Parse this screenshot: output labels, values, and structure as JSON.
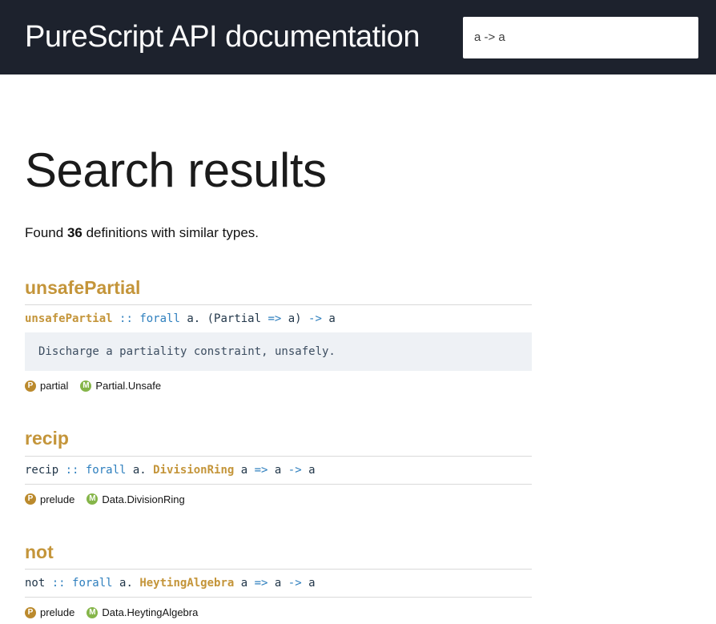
{
  "header": {
    "title": "PureScript API documentation",
    "search": {
      "value": "a -> a"
    }
  },
  "page": {
    "heading": "Search results",
    "summary": {
      "prefix": "Found ",
      "count": "36",
      "suffix": " definitions with similar types."
    }
  },
  "badges": {
    "package_letter": "P",
    "module_letter": "M"
  },
  "results": [
    {
      "title": "unsafePartial",
      "signature": [
        {
          "text": "unsafePartial",
          "kind": "decl"
        },
        {
          "text": " ",
          "kind": "plain"
        },
        {
          "text": "::",
          "kind": "keyword"
        },
        {
          "text": " ",
          "kind": "plain"
        },
        {
          "text": "forall",
          "kind": "keyword"
        },
        {
          "text": " a. (Partial ",
          "kind": "plain"
        },
        {
          "text": "=>",
          "kind": "keyword"
        },
        {
          "text": " a) ",
          "kind": "plain"
        },
        {
          "text": "->",
          "kind": "keyword"
        },
        {
          "text": " a",
          "kind": "plain"
        }
      ],
      "description": "Discharge a partiality constraint, unsafely.",
      "package": "partial",
      "module": "Partial.Unsafe"
    },
    {
      "title": "recip",
      "signature": [
        {
          "text": "recip ",
          "kind": "plain"
        },
        {
          "text": "::",
          "kind": "keyword"
        },
        {
          "text": " ",
          "kind": "plain"
        },
        {
          "text": "forall",
          "kind": "keyword"
        },
        {
          "text": " a. ",
          "kind": "plain"
        },
        {
          "text": "DivisionRing",
          "kind": "decl"
        },
        {
          "text": " a ",
          "kind": "plain"
        },
        {
          "text": "=>",
          "kind": "keyword"
        },
        {
          "text": " a ",
          "kind": "plain"
        },
        {
          "text": "->",
          "kind": "keyword"
        },
        {
          "text": " a",
          "kind": "plain"
        }
      ],
      "description": "",
      "package": "prelude",
      "module": "Data.DivisionRing"
    },
    {
      "title": "not",
      "signature": [
        {
          "text": "not ",
          "kind": "plain"
        },
        {
          "text": "::",
          "kind": "keyword"
        },
        {
          "text": " ",
          "kind": "plain"
        },
        {
          "text": "forall",
          "kind": "keyword"
        },
        {
          "text": " a. ",
          "kind": "plain"
        },
        {
          "text": "HeytingAlgebra",
          "kind": "decl"
        },
        {
          "text": " a ",
          "kind": "plain"
        },
        {
          "text": "=>",
          "kind": "keyword"
        },
        {
          "text": " a ",
          "kind": "plain"
        },
        {
          "text": "->",
          "kind": "keyword"
        },
        {
          "text": " a",
          "kind": "plain"
        }
      ],
      "description": "",
      "package": "prelude",
      "module": "Data.HeytingAlgebra"
    }
  ],
  "colors": {
    "header_bg": "#1d222d",
    "accent_gold": "#c4953a",
    "keyword_blue": "#2e7fbe",
    "code_text": "#22374a",
    "description_bg": "#eef1f5",
    "description_text": "#3c4d60",
    "package_badge": "#bb8a2d",
    "module_badge": "#85b549",
    "rule": "#d9d9d9"
  }
}
